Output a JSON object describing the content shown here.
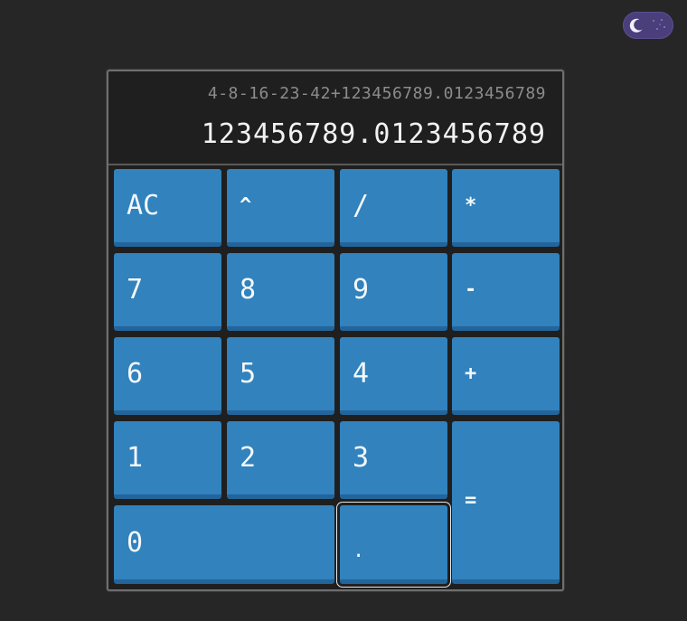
{
  "theme_toggle": {
    "icon": "moon-icon",
    "mode": "dark"
  },
  "display": {
    "expression": "4-8-16-23-42+123456789.0123456789",
    "result": "123456789.0123456789"
  },
  "keys": {
    "ac": "AC",
    "power": "^",
    "divide": "/",
    "multiply": "*",
    "seven": "7",
    "eight": "8",
    "nine": "9",
    "minus": "-",
    "six": "6",
    "five": "5",
    "four": "4",
    "plus": "+",
    "one": "1",
    "two": "2",
    "three": "3",
    "equals": "=",
    "zero": "0",
    "decimal": "."
  },
  "colors": {
    "background": "#262626",
    "key": "#3182bd",
    "key_shadow": "#23659b",
    "toggle": "#4a3f7a"
  }
}
